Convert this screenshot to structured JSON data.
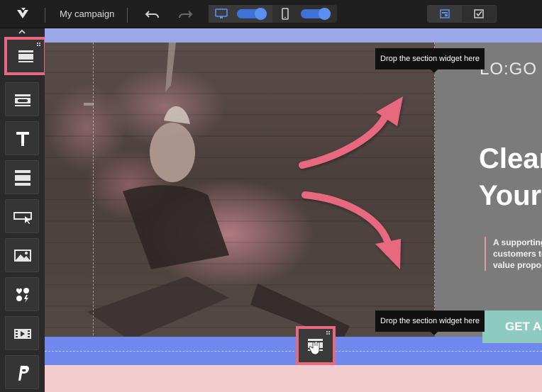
{
  "app": {
    "campaign_name": "My campaign"
  },
  "toolbar": {
    "undo_icon": "undo-icon",
    "redo_icon": "redo-icon",
    "devices": [
      {
        "name": "desktop",
        "icon": "desktop-icon",
        "toggle_on": true
      },
      {
        "name": "mobile",
        "icon": "mobile-icon",
        "toggle_on": true
      }
    ],
    "views": [
      {
        "name": "layout",
        "icon": "layout-icon",
        "active": true
      },
      {
        "name": "checklist",
        "icon": "checkbox-icon",
        "active": false
      }
    ]
  },
  "sidebar": {
    "widgets": [
      {
        "name": "section",
        "icon": "section-widget-icon",
        "highlighted": true
      },
      {
        "name": "button",
        "icon": "button-widget-icon"
      },
      {
        "name": "text",
        "icon": "text-widget-icon"
      },
      {
        "name": "divider",
        "icon": "rows-widget-icon"
      },
      {
        "name": "form",
        "icon": "form-widget-icon"
      },
      {
        "name": "image",
        "icon": "image-widget-icon"
      },
      {
        "name": "social",
        "icon": "social-widget-icon"
      },
      {
        "name": "video",
        "icon": "video-widget-icon"
      },
      {
        "name": "paypal",
        "icon": "paypal-icon"
      }
    ]
  },
  "canvas": {
    "logo_text": "LO:GO",
    "headline_lines": [
      "Clear",
      "Your"
    ],
    "support_lines": [
      "A supporting",
      "customers to",
      "value propos"
    ],
    "cta_label": "GET A",
    "tooltips": {
      "top": "Drop the section widget here",
      "bottom": "Drop the section widget here"
    }
  },
  "colors": {
    "accent_blue": "#5b8ff0",
    "highlight_pink": "#e8697f",
    "drop_zone_blue": "#7088ee",
    "cta_teal": "#8ecbbf"
  }
}
